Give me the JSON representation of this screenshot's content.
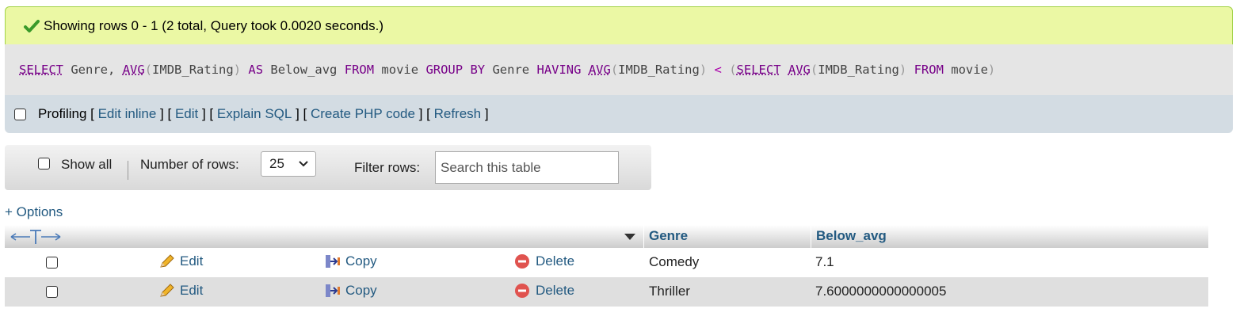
{
  "status": {
    "message": "Showing rows 0 - 1 (2 total, Query took 0.0020 seconds.)"
  },
  "sql": {
    "query": "SELECT Genre, AVG(IMDB_Rating) AS Below_avg FROM movie GROUP BY Genre HAVING AVG(IMDB_Rating) < (SELECT AVG(IMDB_Rating) FROM movie)"
  },
  "profiling": {
    "label": "Profiling",
    "links": [
      "Edit inline",
      "Edit",
      "Explain SQL",
      "Create PHP code",
      "Refresh"
    ]
  },
  "navigation": {
    "show_all_label": "Show all",
    "number_of_rows_label": "Number of rows:",
    "number_of_rows_value": "25",
    "filter_rows_label": "Filter rows:",
    "search_placeholder": "Search this table"
  },
  "options_label": "+ Options",
  "table": {
    "columns": [
      "Genre",
      "Below_avg"
    ],
    "actions": {
      "edit": "Edit",
      "copy": "Copy",
      "delete": "Delete"
    },
    "rows": [
      {
        "Genre": "Comedy",
        "Below_avg": "7.1"
      },
      {
        "Genre": "Thriller",
        "Below_avg": "7.6000000000000005"
      }
    ]
  },
  "colors": {
    "success_bg": "#ebf8a4",
    "sql_bg": "#e5e5e5",
    "profiling_bg": "#d3dce3",
    "link": "#235a81",
    "keyword": "#770088"
  }
}
